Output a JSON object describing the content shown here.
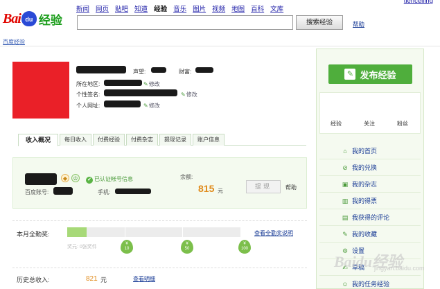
{
  "logo": {
    "text_left": "Bai",
    "paw_text": "du",
    "text_right": "经验"
  },
  "topnav": [
    "新闻",
    "网页",
    "贴吧",
    "知道",
    "经验",
    "音乐",
    "图片",
    "视频",
    "地图",
    "百科",
    "文库"
  ],
  "topnav_current": "经验",
  "user_name": "tiencelling",
  "search": {
    "button": "搜索经验",
    "help": "帮助"
  },
  "breadcrumb": "百度经验",
  "profile": {
    "prestige_label": "声望:",
    "wealth_label": "财富:",
    "location_label": "所在地区:",
    "signature_label": "个性签名:",
    "website_label": "个人网址:",
    "edit": "修改"
  },
  "tabs": [
    "收入概况",
    "每日收入",
    "付费经验",
    "付费杂志",
    "提现记录",
    "账户信息"
  ],
  "income": {
    "verified": "已认证帐号信息",
    "account_label": "百度账号:",
    "phone_label": "手机:",
    "balance_label": "余额:",
    "balance": "815",
    "balance_unit": "元",
    "withdraw": "提现",
    "help": "帮助"
  },
  "attendance": {
    "label": "本月全勤奖:",
    "link": "查看全勤奖说明",
    "progress_note": "奖元: 0张奖件",
    "progress": 0.11,
    "milestones": [
      {
        "icon": "¥",
        "value": "10"
      },
      {
        "icon": "¥",
        "value": "50"
      },
      {
        "icon": "¥",
        "value": "100"
      }
    ]
  },
  "history": {
    "label": "历史总收入:",
    "value": "821",
    "unit": "元",
    "link": "查看明细"
  },
  "sidebar": {
    "publish": "发布经验",
    "stats": [
      "经验",
      "关注",
      "粉丝"
    ],
    "items": [
      {
        "icon": "home-icon",
        "glyph": "⌂",
        "label": "我的首页"
      },
      {
        "icon": "exchange-icon",
        "glyph": "⊘",
        "label": "我的兑换"
      },
      {
        "icon": "magazine-icon",
        "glyph": "▣",
        "label": "我的杂志"
      },
      {
        "icon": "chart-icon",
        "glyph": "▥",
        "label": "我的得票"
      },
      {
        "icon": "comment-icon",
        "glyph": "▤",
        "label": "我获得的评论"
      },
      {
        "icon": "favorite-icon",
        "glyph": "✎",
        "label": "我的收藏"
      },
      {
        "icon": "settings-icon",
        "glyph": "⚙",
        "label": "设置"
      },
      {
        "icon": "draft-icon",
        "glyph": "✍",
        "label": "草稿"
      },
      {
        "icon": "task-icon",
        "glyph": "☺",
        "label": "我的任务经验"
      }
    ]
  },
  "watermark": {
    "main": "Baidu经验",
    "sub": "jingyan.baidu.com"
  },
  "colors": {
    "brand_green": "#4fae3c",
    "brand_red": "#e10601",
    "brand_blue": "#2a4ad6",
    "amount_orange": "#e08a1a"
  }
}
